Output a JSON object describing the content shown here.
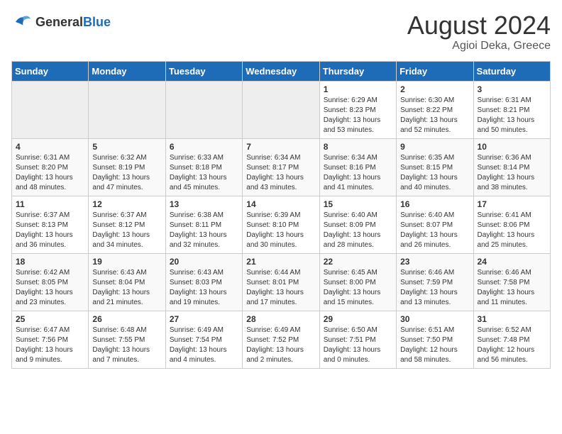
{
  "header": {
    "logo_general": "General",
    "logo_blue": "Blue",
    "title": "August 2024",
    "subtitle": "Agioi Deka, Greece"
  },
  "calendar": {
    "days_of_week": [
      "Sunday",
      "Monday",
      "Tuesday",
      "Wednesday",
      "Thursday",
      "Friday",
      "Saturday"
    ],
    "weeks": [
      [
        {
          "num": "",
          "empty": true
        },
        {
          "num": "",
          "empty": true
        },
        {
          "num": "",
          "empty": true
        },
        {
          "num": "",
          "empty": true
        },
        {
          "num": "1",
          "sunrise": "6:29 AM",
          "sunset": "8:23 PM",
          "daylight": "13 hours and 53 minutes."
        },
        {
          "num": "2",
          "sunrise": "6:30 AM",
          "sunset": "8:22 PM",
          "daylight": "13 hours and 52 minutes."
        },
        {
          "num": "3",
          "sunrise": "6:31 AM",
          "sunset": "8:21 PM",
          "daylight": "13 hours and 50 minutes."
        }
      ],
      [
        {
          "num": "4",
          "sunrise": "6:31 AM",
          "sunset": "8:20 PM",
          "daylight": "13 hours and 48 minutes."
        },
        {
          "num": "5",
          "sunrise": "6:32 AM",
          "sunset": "8:19 PM",
          "daylight": "13 hours and 47 minutes."
        },
        {
          "num": "6",
          "sunrise": "6:33 AM",
          "sunset": "8:18 PM",
          "daylight": "13 hours and 45 minutes."
        },
        {
          "num": "7",
          "sunrise": "6:34 AM",
          "sunset": "8:17 PM",
          "daylight": "13 hours and 43 minutes."
        },
        {
          "num": "8",
          "sunrise": "6:34 AM",
          "sunset": "8:16 PM",
          "daylight": "13 hours and 41 minutes."
        },
        {
          "num": "9",
          "sunrise": "6:35 AM",
          "sunset": "8:15 PM",
          "daylight": "13 hours and 40 minutes."
        },
        {
          "num": "10",
          "sunrise": "6:36 AM",
          "sunset": "8:14 PM",
          "daylight": "13 hours and 38 minutes."
        }
      ],
      [
        {
          "num": "11",
          "sunrise": "6:37 AM",
          "sunset": "8:13 PM",
          "daylight": "13 hours and 36 minutes."
        },
        {
          "num": "12",
          "sunrise": "6:37 AM",
          "sunset": "8:12 PM",
          "daylight": "13 hours and 34 minutes."
        },
        {
          "num": "13",
          "sunrise": "6:38 AM",
          "sunset": "8:11 PM",
          "daylight": "13 hours and 32 minutes."
        },
        {
          "num": "14",
          "sunrise": "6:39 AM",
          "sunset": "8:10 PM",
          "daylight": "13 hours and 30 minutes."
        },
        {
          "num": "15",
          "sunrise": "6:40 AM",
          "sunset": "8:09 PM",
          "daylight": "13 hours and 28 minutes."
        },
        {
          "num": "16",
          "sunrise": "6:40 AM",
          "sunset": "8:07 PM",
          "daylight": "13 hours and 26 minutes."
        },
        {
          "num": "17",
          "sunrise": "6:41 AM",
          "sunset": "8:06 PM",
          "daylight": "13 hours and 25 minutes."
        }
      ],
      [
        {
          "num": "18",
          "sunrise": "6:42 AM",
          "sunset": "8:05 PM",
          "daylight": "13 hours and 23 minutes."
        },
        {
          "num": "19",
          "sunrise": "6:43 AM",
          "sunset": "8:04 PM",
          "daylight": "13 hours and 21 minutes."
        },
        {
          "num": "20",
          "sunrise": "6:43 AM",
          "sunset": "8:03 PM",
          "daylight": "13 hours and 19 minutes."
        },
        {
          "num": "21",
          "sunrise": "6:44 AM",
          "sunset": "8:01 PM",
          "daylight": "13 hours and 17 minutes."
        },
        {
          "num": "22",
          "sunrise": "6:45 AM",
          "sunset": "8:00 PM",
          "daylight": "13 hours and 15 minutes."
        },
        {
          "num": "23",
          "sunrise": "6:46 AM",
          "sunset": "7:59 PM",
          "daylight": "13 hours and 13 minutes."
        },
        {
          "num": "24",
          "sunrise": "6:46 AM",
          "sunset": "7:58 PM",
          "daylight": "13 hours and 11 minutes."
        }
      ],
      [
        {
          "num": "25",
          "sunrise": "6:47 AM",
          "sunset": "7:56 PM",
          "daylight": "13 hours and 9 minutes."
        },
        {
          "num": "26",
          "sunrise": "6:48 AM",
          "sunset": "7:55 PM",
          "daylight": "13 hours and 7 minutes."
        },
        {
          "num": "27",
          "sunrise": "6:49 AM",
          "sunset": "7:54 PM",
          "daylight": "13 hours and 4 minutes."
        },
        {
          "num": "28",
          "sunrise": "6:49 AM",
          "sunset": "7:52 PM",
          "daylight": "13 hours and 2 minutes."
        },
        {
          "num": "29",
          "sunrise": "6:50 AM",
          "sunset": "7:51 PM",
          "daylight": "13 hours and 0 minutes."
        },
        {
          "num": "30",
          "sunrise": "6:51 AM",
          "sunset": "7:50 PM",
          "daylight": "12 hours and 58 minutes."
        },
        {
          "num": "31",
          "sunrise": "6:52 AM",
          "sunset": "7:48 PM",
          "daylight": "12 hours and 56 minutes."
        }
      ]
    ]
  }
}
